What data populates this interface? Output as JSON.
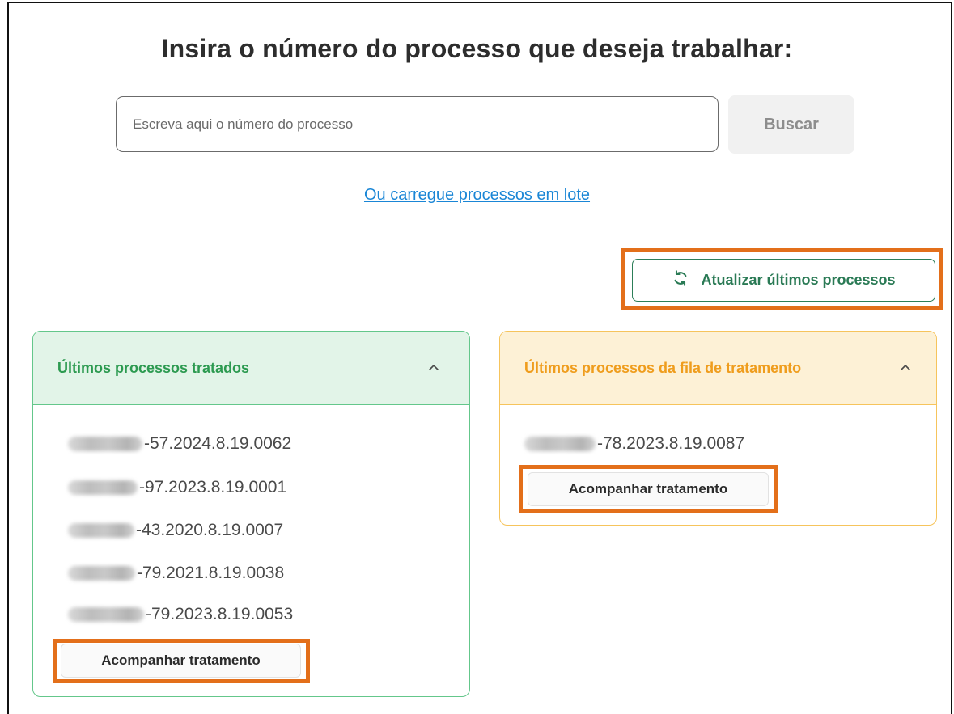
{
  "page": {
    "title": "Insira o número do processo que deseja trabalhar:"
  },
  "search": {
    "placeholder": "Escreva aqui o número do processo",
    "value": "",
    "button_label": "Buscar"
  },
  "batch_link": "Ou carregue processos em lote",
  "refresh": {
    "label": "Atualizar últimos processos",
    "icon": "refresh-icon"
  },
  "treated_panel": {
    "title": "Últimos processos tratados",
    "items": [
      "-57.2024.8.19.0062",
      "-97.2023.8.19.0001",
      "-43.2020.8.19.0007",
      "-79.2021.8.19.0038",
      "-79.2023.8.19.0053"
    ],
    "button_label": "Acompanhar tratamento"
  },
  "queue_panel": {
    "title": "Últimos processos da fila de tratamento",
    "items": [
      "-78.2023.8.19.0087"
    ],
    "button_label": "Acompanhar tratamento"
  },
  "colors": {
    "highlight": "#e36f1a",
    "link": "#1a86d6",
    "green_accent": "#2c9a50",
    "yellow_accent": "#ef9d1d"
  }
}
